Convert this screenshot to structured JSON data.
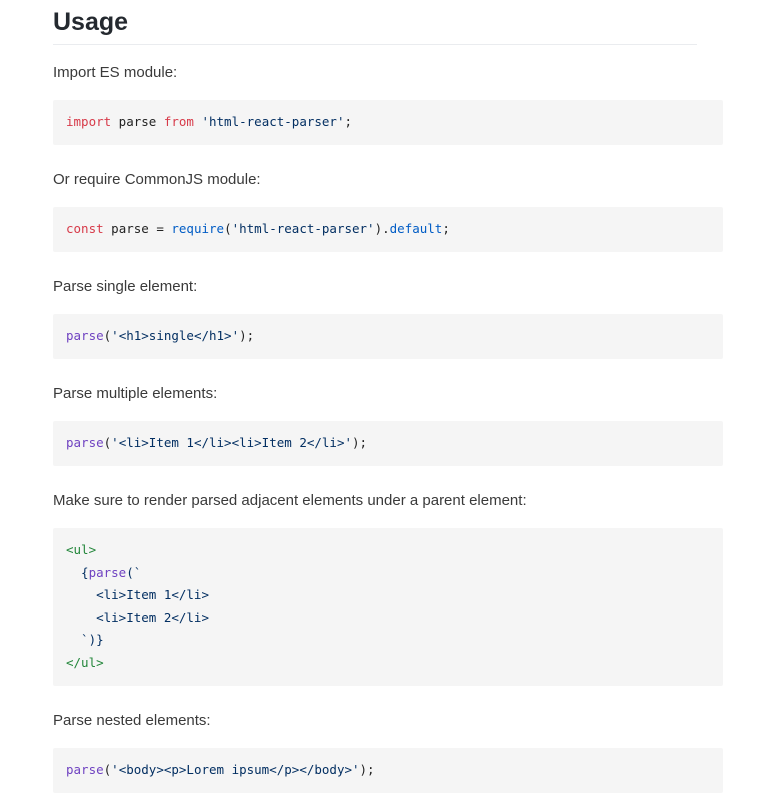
{
  "heading": "Usage",
  "sections": [
    {
      "text": "Import ES module:",
      "code": {
        "kw1": "import",
        "mid": " parse ",
        "kw2": "from",
        "sp": " ",
        "str": "'html-react-parser'",
        "end": ";"
      }
    },
    {
      "text": "Or require CommonJS module:",
      "code": {
        "kw": "const",
        "mid": " parse = ",
        "fn": "require",
        "open": "(",
        "str": "'html-react-parser'",
        "close": ").",
        "prop": "default",
        "end": ";"
      }
    },
    {
      "text": "Parse single element:",
      "code": {
        "fn": "parse",
        "open": "(",
        "str": "'<h1>single</h1>'",
        "end": ");"
      }
    },
    {
      "text": "Parse multiple elements:",
      "code": {
        "fn": "parse",
        "open": "(",
        "str": "'<li>Item 1</li><li>Item 2</li>'",
        "end": ");"
      }
    },
    {
      "text": "Make sure to render parsed adjacent elements under a parent element:",
      "code": {
        "line1": "<ul>",
        "line2_brace": "  {",
        "line2_fn": "parse",
        "line2_rest": "(`",
        "line3": "    <li>Item 1</li>",
        "line4": "    <li>Item 2</li>",
        "line5": "  `)}",
        "line6": "</ul>"
      }
    },
    {
      "text": "Parse nested elements:",
      "code": {
        "fn": "parse",
        "open": "(",
        "str": "'<body><p>Lorem ipsum</p></body>'",
        "end": ");"
      }
    }
  ]
}
